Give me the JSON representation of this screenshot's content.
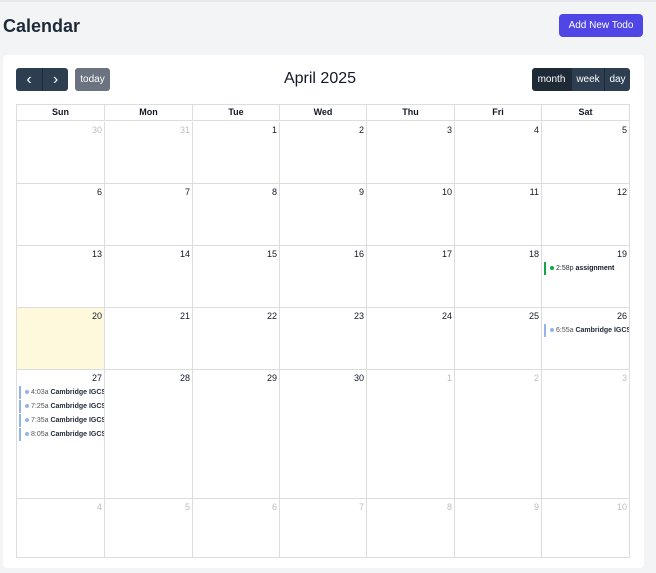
{
  "page_title": "Calendar",
  "add_button": "Add New Todo",
  "toolbar": {
    "prev_icon": "chevron-left-icon",
    "next_icon": "chevron-right-icon",
    "prev_glyph": "‹",
    "next_glyph": "›",
    "today": "today",
    "title": "April 2025",
    "views": [
      "month",
      "week",
      "day"
    ],
    "active_view": "month"
  },
  "weekdays": [
    "Sun",
    "Mon",
    "Tue",
    "Wed",
    "Thu",
    "Fri",
    "Sat"
  ],
  "weeks": [
    [
      {
        "d": "30",
        "other": true
      },
      {
        "d": "31",
        "other": true
      },
      {
        "d": "1"
      },
      {
        "d": "2"
      },
      {
        "d": "3"
      },
      {
        "d": "4"
      },
      {
        "d": "5"
      }
    ],
    [
      {
        "d": "6"
      },
      {
        "d": "7"
      },
      {
        "d": "8"
      },
      {
        "d": "9"
      },
      {
        "d": "10"
      },
      {
        "d": "11"
      },
      {
        "d": "12"
      }
    ],
    [
      {
        "d": "13"
      },
      {
        "d": "14"
      },
      {
        "d": "15"
      },
      {
        "d": "16"
      },
      {
        "d": "17"
      },
      {
        "d": "18"
      },
      {
        "d": "19",
        "events": [
          {
            "time": "2:58p",
            "title": "assignment",
            "color": "green"
          }
        ]
      }
    ],
    [
      {
        "d": "20",
        "today": true
      },
      {
        "d": "21"
      },
      {
        "d": "22"
      },
      {
        "d": "23"
      },
      {
        "d": "24"
      },
      {
        "d": "25"
      },
      {
        "d": "26",
        "events": [
          {
            "time": "6:55a",
            "title": "Cambridge IGCSE",
            "color": "blue"
          }
        ]
      }
    ],
    [
      {
        "d": "27",
        "events": [
          {
            "time": "4:03a",
            "title": "Cambridge IGCSE",
            "color": "blue"
          },
          {
            "time": "7:25a",
            "title": "Cambridge IGCSE",
            "color": "blue"
          },
          {
            "time": "7:35a",
            "title": "Cambridge IGCSE",
            "color": "blue"
          },
          {
            "time": "8:05a",
            "title": "Cambridge IGCSE",
            "color": "blue"
          }
        ]
      },
      {
        "d": "28"
      },
      {
        "d": "29"
      },
      {
        "d": "30"
      },
      {
        "d": "1",
        "other": true
      },
      {
        "d": "2",
        "other": true
      },
      {
        "d": "3",
        "other": true
      }
    ],
    [
      {
        "d": "4",
        "other": true
      },
      {
        "d": "5",
        "other": true
      },
      {
        "d": "6",
        "other": true
      },
      {
        "d": "7",
        "other": true
      },
      {
        "d": "8",
        "other": true
      },
      {
        "d": "9",
        "other": true
      },
      {
        "d": "10",
        "other": true
      }
    ]
  ],
  "colors": {
    "primary": "#4f46e5",
    "toolbar": "#2c3e50",
    "today_bg": "#fef9dc",
    "event_blue": "#93b4e8",
    "event_green": "#16a34a"
  }
}
